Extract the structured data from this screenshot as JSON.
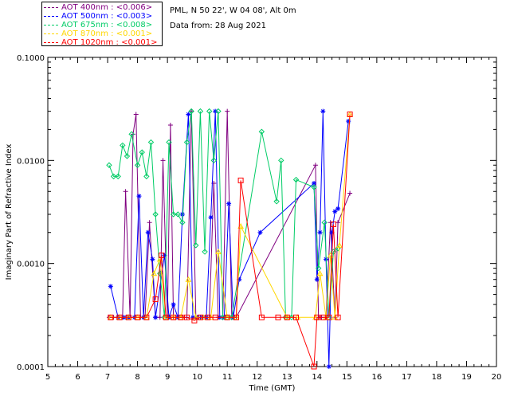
{
  "header": {
    "location": "PML, N 50 22', W 04 08', Alt 0m",
    "date_line": "Data from: 28 Aug 2021"
  },
  "legend": [
    {
      "label": "AOT  400nm : <0.006>",
      "color": "#800080"
    },
    {
      "label": "AOT  500nm : <0.003>",
      "color": "#0000ff"
    },
    {
      "label": "AOT  675nm : <0.008>",
      "color": "#00cc66"
    },
    {
      "label": "AOT  870nm : <0.001>",
      "color": "#ffd700"
    },
    {
      "label": "AOT 1020nm : <0.001>",
      "color": "#ff0000"
    }
  ],
  "chart_data": {
    "type": "line",
    "xlabel": "Time (GMT)",
    "ylabel": "Imaginary Part of Refractive Index",
    "xlim": [
      5,
      20
    ],
    "ylim": [
      0.0001,
      0.1
    ],
    "yscale": "log",
    "x_ticks": [
      "5",
      "6",
      "7",
      "8",
      "9",
      "10",
      "11",
      "12",
      "13",
      "14",
      "15",
      "16",
      "17",
      "18",
      "19",
      "20"
    ],
    "y_ticks": [
      "0.0001",
      "0.0010",
      "0.0100",
      "0.1000"
    ],
    "series": [
      {
        "name": "AOT  400nm : <0.006>",
        "color": "#800080",
        "marker": "plus",
        "x": [
          7.05,
          7.2,
          7.35,
          7.5,
          7.6,
          7.75,
          7.85,
          7.95,
          8.1,
          8.25,
          8.4,
          8.6,
          8.75,
          8.85,
          9.0,
          9.1,
          9.2,
          9.35,
          9.5,
          9.65,
          9.8,
          9.95,
          10.1,
          10.25,
          10.4,
          10.55,
          10.7,
          10.85,
          11.0,
          11.15,
          11.3,
          13.95,
          14.05,
          14.15,
          14.3,
          14.45,
          14.6,
          14.7,
          15.1
        ],
        "y": [
          0.0003,
          0.0003,
          0.0003,
          0.0003,
          0.005,
          0.0003,
          0.018,
          0.028,
          0.0003,
          0.0003,
          0.0025,
          0.0003,
          0.0003,
          0.01,
          0.0003,
          0.022,
          0.0003,
          0.0003,
          0.0003,
          0.0003,
          0.03,
          0.0003,
          0.0003,
          0.0003,
          0.0003,
          0.006,
          0.0003,
          0.0003,
          0.03,
          0.0003,
          0.0003,
          0.009,
          0.0003,
          0.0003,
          0.0003,
          0.0025,
          0.0003,
          0.0025,
          0.0048
        ]
      },
      {
        "name": "AOT  500nm : <0.003>",
        "color": "#0000ff",
        "marker": "asterisk",
        "x": [
          7.1,
          7.35,
          7.55,
          7.7,
          7.9,
          8.05,
          8.2,
          8.35,
          8.5,
          8.6,
          8.9,
          9.05,
          9.2,
          9.35,
          9.5,
          9.7,
          9.85,
          10.0,
          10.15,
          10.3,
          10.45,
          10.6,
          10.75,
          10.9,
          11.05,
          11.2,
          11.4,
          12.1,
          13.9,
          14.0,
          14.1,
          14.2,
          14.3,
          14.4,
          14.5,
          14.6,
          14.7,
          15.05
        ],
        "y": [
          0.0006,
          0.0003,
          0.0003,
          0.0003,
          0.0003,
          0.0045,
          0.0003,
          0.002,
          0.0011,
          0.0003,
          0.0012,
          0.0003,
          0.0004,
          0.0003,
          0.003,
          0.028,
          0.0003,
          0.0003,
          0.0003,
          0.0003,
          0.0028,
          0.03,
          0.0003,
          0.0003,
          0.0038,
          0.0003,
          0.0007,
          0.002,
          0.006,
          0.0007,
          0.002,
          0.03,
          0.0011,
          0.0001,
          0.002,
          0.0032,
          0.0034,
          0.024
        ]
      },
      {
        "name": "AOT  675nm : <0.008>",
        "color": "#00cc66",
        "marker": "diamond",
        "x": [
          7.05,
          7.2,
          7.35,
          7.5,
          7.65,
          7.8,
          8.0,
          8.15,
          8.3,
          8.45,
          8.6,
          8.75,
          8.9,
          9.05,
          9.2,
          9.35,
          9.5,
          9.65,
          9.8,
          9.95,
          10.1,
          10.25,
          10.4,
          10.55,
          10.7,
          10.85,
          11.0,
          11.15,
          12.15,
          12.65,
          12.8,
          12.95,
          13.15,
          13.3,
          13.9,
          14.05,
          14.25,
          14.4,
          14.55,
          14.7
        ],
        "y": [
          0.009,
          0.007,
          0.007,
          0.014,
          0.011,
          0.018,
          0.009,
          0.012,
          0.007,
          0.015,
          0.003,
          0.0008,
          0.0003,
          0.015,
          0.003,
          0.003,
          0.0025,
          0.015,
          0.03,
          0.0015,
          0.03,
          0.0013,
          0.03,
          0.01,
          0.03,
          0.0003,
          0.0003,
          0.0003,
          0.019,
          0.004,
          0.01,
          0.0003,
          0.0003,
          0.0065,
          0.0055,
          0.0009,
          0.0025,
          0.0003,
          0.0013,
          0.0014
        ]
      },
      {
        "name": "AOT  870nm : <0.001>",
        "color": "#ffd700",
        "marker": "triangle",
        "x": [
          7.1,
          7.4,
          7.7,
          8.0,
          8.3,
          8.55,
          8.75,
          8.95,
          9.2,
          9.45,
          9.7,
          9.95,
          10.2,
          10.45,
          10.7,
          11.0,
          11.3,
          11.45,
          13.0,
          13.35,
          13.95,
          14.1,
          14.3,
          14.45,
          14.6,
          14.75,
          15.1
        ],
        "y": [
          0.0003,
          0.0003,
          0.0003,
          0.0003,
          0.0003,
          0.0008,
          0.0011,
          0.0003,
          0.0003,
          0.0003,
          0.0007,
          0.0003,
          0.0003,
          0.0003,
          0.0013,
          0.0003,
          0.0003,
          0.0023,
          0.0003,
          0.0003,
          0.0003,
          0.0008,
          0.0003,
          0.0012,
          0.0003,
          0.0015,
          0.028
        ]
      },
      {
        "name": "AOT 1020nm : <0.001>",
        "color": "#ff0000",
        "marker": "square",
        "x": [
          7.1,
          7.4,
          7.7,
          8.0,
          8.3,
          8.6,
          8.8,
          8.95,
          9.2,
          9.45,
          9.65,
          9.9,
          10.1,
          10.35,
          10.6,
          11.0,
          11.3,
          11.45,
          12.15,
          12.7,
          13.0,
          13.3,
          13.9,
          14.0,
          14.2,
          14.4,
          14.55,
          14.7,
          15.1
        ],
        "y": [
          0.0003,
          0.0003,
          0.0003,
          0.0003,
          0.0003,
          0.00045,
          0.0012,
          0.0003,
          0.0003,
          0.0003,
          0.0003,
          0.00028,
          0.0003,
          0.0003,
          0.0003,
          0.0003,
          0.0003,
          0.0064,
          0.0003,
          0.0003,
          0.0003,
          0.0003,
          0.0001,
          0.0003,
          0.0003,
          0.0003,
          0.0024,
          0.0003,
          0.028
        ]
      }
    ]
  }
}
